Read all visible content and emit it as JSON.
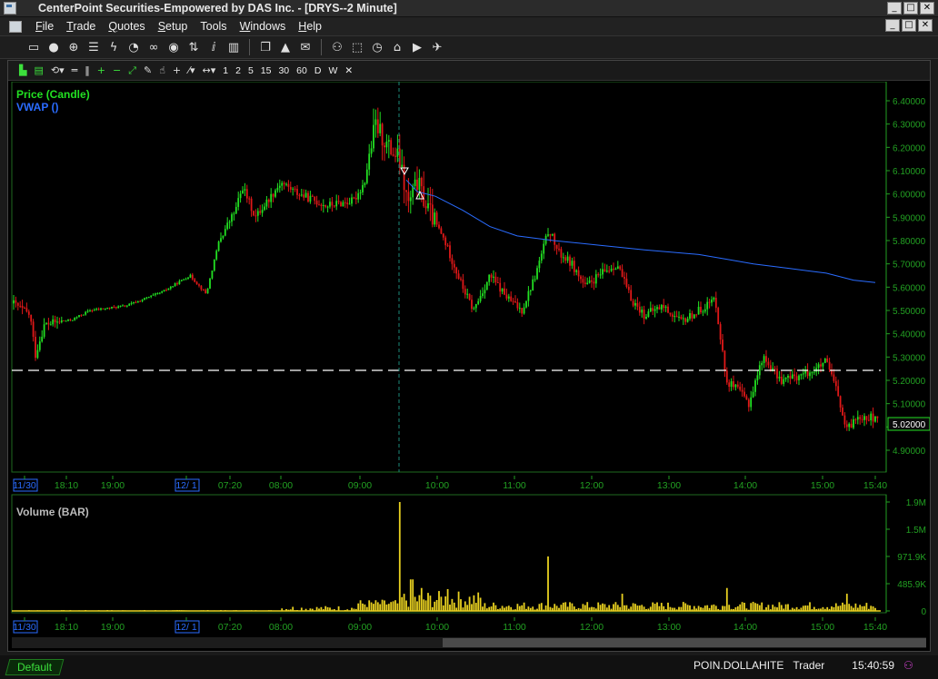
{
  "window": {
    "title": "CenterPoint Securities-Empowered by DAS Inc. - [DRYS--2 Minute]",
    "buttons": {
      "minimize": "_",
      "maximize": "□",
      "close": "✕"
    }
  },
  "menu": {
    "items": [
      "File",
      "Trade",
      "Quotes",
      "Setup",
      "Tools",
      "Windows",
      "Help"
    ],
    "underline": [
      "F",
      "T",
      "Q",
      "S",
      "",
      "W",
      "H"
    ]
  },
  "toolbar": {
    "icons": [
      "window-icon",
      "user-icon",
      "globe-icon",
      "list-icon",
      "lightning-icon",
      "clock-icon",
      "link-icon",
      "eye-icon",
      "sort-icon",
      "info-icon",
      "bar-chart-icon",
      "copy-icon",
      "alert-icon",
      "mail-icon",
      "network-icon",
      "select-icon",
      "timer-icon",
      "home-icon",
      "youtube-icon",
      "twitter-icon"
    ]
  },
  "chart_toolbar": {
    "periods": [
      "1",
      "2",
      "5",
      "15",
      "30",
      "60",
      "D",
      "W"
    ],
    "close": "✕"
  },
  "price_pane": {
    "legend": [
      {
        "label": "Price (Candle)",
        "color": "#22e022"
      },
      {
        "label": "VWAP ()",
        "color": "#2a6cff"
      }
    ],
    "y_ticks": [
      "6.40000",
      "6.30000",
      "6.20000",
      "6.10000",
      "6.00000",
      "5.90000",
      "5.80000",
      "5.70000",
      "5.60000",
      "5.50000",
      "5.40000",
      "5.30000",
      "5.20000",
      "5.10000",
      "5.00000",
      "4.90000"
    ],
    "last_price": "5.02000",
    "x_labels": [
      "11/30",
      "18:10",
      "19:00",
      "12/ 1",
      "07:20",
      "08:00",
      "09:00",
      "10:00",
      "11:00",
      "12:00",
      "13:00",
      "14:00",
      "15:00",
      "15:40"
    ]
  },
  "volume_pane": {
    "title": "Volume (BAR)",
    "y_ticks": [
      "1.9M",
      "1.5M",
      "971.9K",
      "485.9K",
      "0"
    ],
    "x_labels": [
      "11/30",
      "18:10",
      "19:00",
      "12/ 1",
      "07:20",
      "08:00",
      "09:00",
      "10:00",
      "11:00",
      "12:00",
      "13:00",
      "14:00",
      "15:00",
      "15:40"
    ]
  },
  "status": {
    "tab": "Default",
    "user": "POIN.DOLLAHITE",
    "role": "Trader",
    "time": "15:40:59"
  },
  "colors": {
    "up": "#22e022",
    "down": "#e01818",
    "vwap": "#2a6cff",
    "volume": "#e8d020",
    "axis": "#22a022"
  }
}
